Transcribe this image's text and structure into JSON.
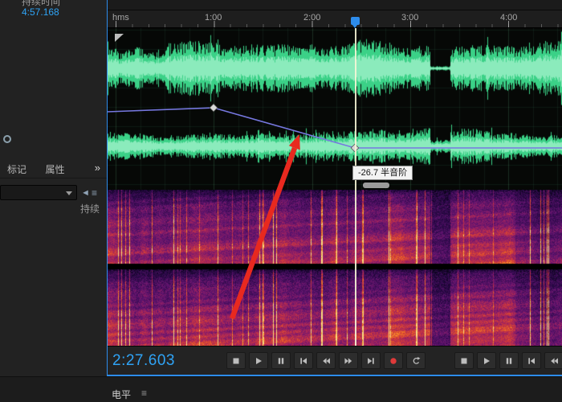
{
  "colors": {
    "accent_blue": "#2d8ceb",
    "timecode_blue": "#2fa3f5",
    "wave_green": "#3edc8e",
    "wave_green_light": "#9af0c6",
    "envelope_purple": "#7678e0",
    "record_red": "#e03a3a",
    "arrow_red": "#e8291f",
    "playhead_line": "#f6f6d6"
  },
  "left_panel": {
    "duration_header": "持续时间",
    "duration_value": "4:57.168",
    "tabs": [
      {
        "label": "标记"
      },
      {
        "label": "属性"
      }
    ],
    "overflow_icon": "»",
    "combo_value": "",
    "back_icon": "◄",
    "menu_icon": "≡",
    "column_label": "持续"
  },
  "ruler": {
    "unit_label": "hms",
    "tick_labels": [
      "1:00",
      "2:00",
      "3:00",
      "4:00"
    ]
  },
  "editor": {
    "tooltip_text": "-26.7 半音阶"
  },
  "transport": {
    "timecode": "2:27.603",
    "primary_buttons": [
      {
        "icon": "stop-icon"
      },
      {
        "icon": "play-icon"
      },
      {
        "icon": "pause-icon"
      },
      {
        "icon": "skip-previous-icon"
      },
      {
        "icon": "rewind-icon"
      },
      {
        "icon": "fast-forward-icon"
      },
      {
        "icon": "skip-next-icon"
      },
      {
        "icon": "record-icon"
      },
      {
        "icon": "loop-icon"
      }
    ],
    "secondary_buttons": [
      {
        "icon": "stop-icon"
      },
      {
        "icon": "play-icon"
      },
      {
        "icon": "pause-icon"
      },
      {
        "icon": "skip-previous-icon"
      },
      {
        "icon": "rewind-icon"
      }
    ]
  },
  "levels_panel": {
    "title": "电平",
    "menu_icon": "≡"
  }
}
